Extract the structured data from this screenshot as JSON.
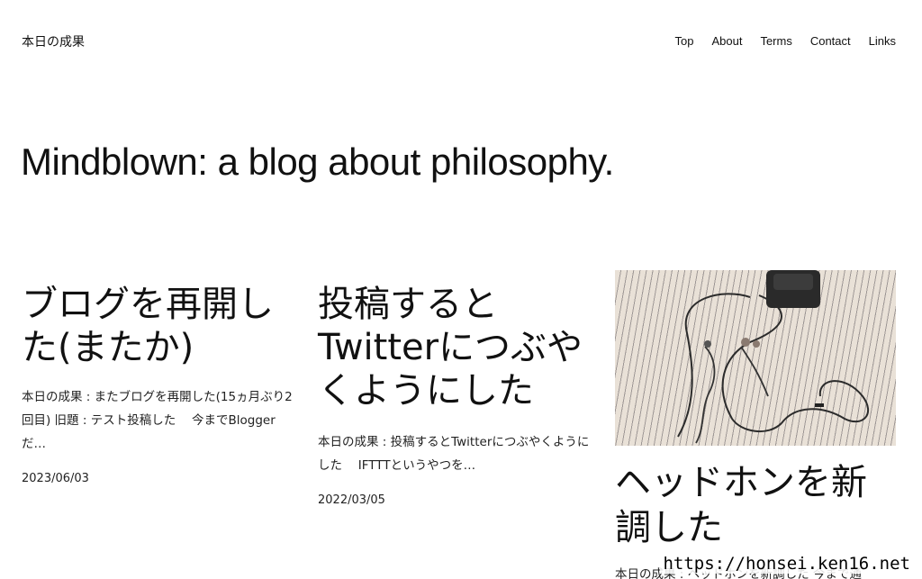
{
  "site": {
    "title": "本日の成果",
    "tagline": "Mindblown: a blog about philosophy."
  },
  "nav": {
    "items": [
      "Top",
      "About",
      "Terms",
      "Contact",
      "Links"
    ]
  },
  "posts": [
    {
      "title": "ブログを再開した(またか)",
      "excerpt": "本日の成果 : またブログを再開した(15ヵ月ぶり2回目) 旧題 : テスト投稿した　 今までBloggerだ…",
      "date": "2023/06/03"
    },
    {
      "title": "投稿するとTwitterにつぶやくようにした",
      "excerpt": "本日の成果 : 投稿するとTwitterにつぶやくようにした　 IFTTTというやつを…",
      "date": "2022/03/05"
    },
    {
      "title": "ヘッドホンを新調した",
      "excerpt": "本日の成果 : ヘッドホンを新調した 今まで通",
      "image_alt": "headphones-cable-on-striped-fabric"
    }
  ],
  "watermark": "https://honsei.ken16.net"
}
